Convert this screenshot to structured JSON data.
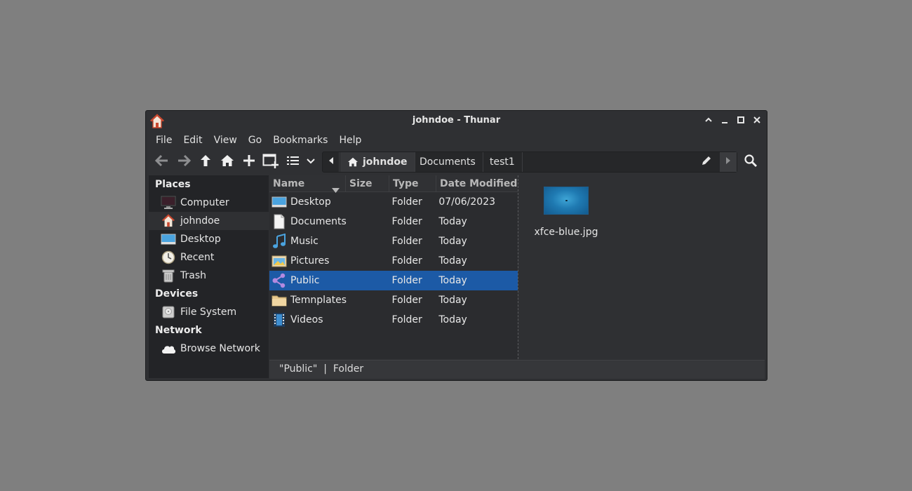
{
  "window": {
    "title": "johndoe - Thunar"
  },
  "menu": [
    "File",
    "Edit",
    "View",
    "Go",
    "Bookmarks",
    "Help"
  ],
  "pathbar": {
    "crumbs": [
      "johndoe",
      "Documents",
      "test1"
    ]
  },
  "sidebar": {
    "places_header": "Places",
    "places": [
      "Computer",
      "johndoe",
      "Desktop",
      "Recent",
      "Trash"
    ],
    "devices_header": "Devices",
    "devices": [
      "File System"
    ],
    "network_header": "Network",
    "network": [
      "Browse Network"
    ]
  },
  "columns": {
    "name": "Name",
    "size": "Size",
    "type": "Type",
    "date": "Date Modified"
  },
  "files": [
    {
      "name": "Desktop",
      "type": "Folder",
      "date": "07/06/2023"
    },
    {
      "name": "Documents",
      "type": "Folder",
      "date": "Today"
    },
    {
      "name": "Music",
      "type": "Folder",
      "date": "Today"
    },
    {
      "name": "Pictures",
      "type": "Folder",
      "date": "Today"
    },
    {
      "name": "Public",
      "type": "Folder",
      "date": "Today"
    },
    {
      "name": "Temnplates",
      "type": "Folder",
      "date": "Today"
    },
    {
      "name": "Videos",
      "type": "Folder",
      "date": "Today"
    }
  ],
  "preview": {
    "filename": "xfce-blue.jpg"
  },
  "status": {
    "text": "\"Public\"  |  Folder"
  },
  "colors": {
    "selection": "#1c5aa6",
    "window_bg": "#2f3033",
    "desktop_bg": "#7f7f7f"
  }
}
